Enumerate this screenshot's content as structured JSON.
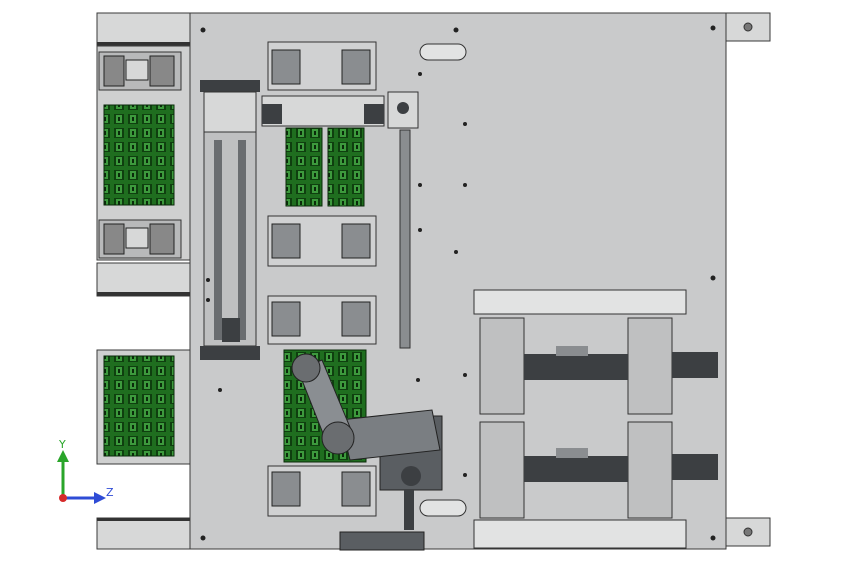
{
  "triad": {
    "y_label": "Y",
    "z_label": "Z"
  },
  "colors": {
    "plate": "#c9cacb",
    "plate_edge": "#3a3a3a",
    "rail": "#d7d8d8",
    "dark": "#3c3f42",
    "gear": "#5a5e62",
    "pcb": "#1f6e1f",
    "pcb_dark": "#0f3f0f",
    "axis_y": "#2aa52a",
    "axis_z": "#2f4cd6",
    "axis_x": "#d62a2a"
  }
}
